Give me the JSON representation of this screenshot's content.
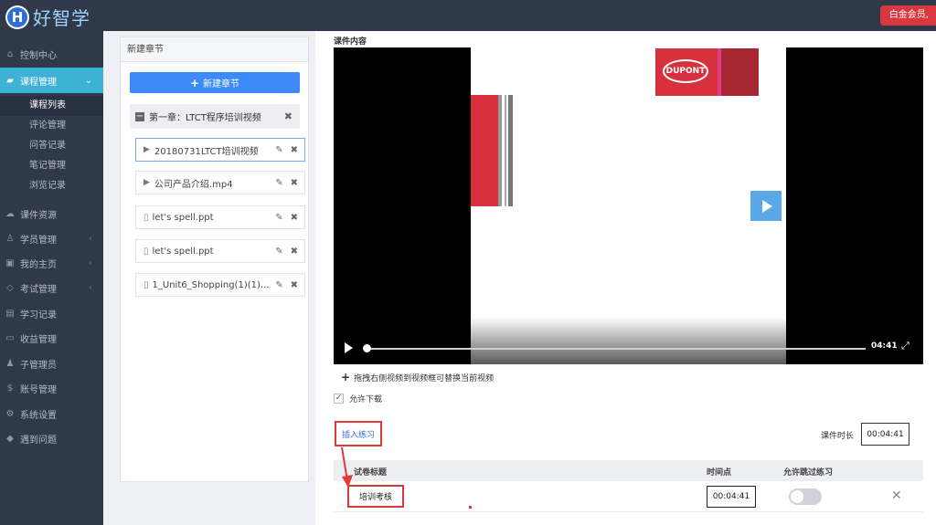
{
  "app": {
    "logo_letter": "H",
    "logo_text": "好智学",
    "member_badge": "白金会员,"
  },
  "sidebar": {
    "items": [
      {
        "label": "控制中心",
        "icon": "home-icon"
      },
      {
        "label": "课程管理",
        "icon": "book-icon",
        "active": true
      },
      {
        "label": "课件资源",
        "icon": "cloud-icon"
      },
      {
        "label": "学员管理",
        "icon": "users-icon"
      },
      {
        "label": "我的主页",
        "icon": "bookmark-icon"
      },
      {
        "label": "考试管理",
        "icon": "tag-icon"
      },
      {
        "label": "学习记录",
        "icon": "doc-icon"
      },
      {
        "label": "收益管理",
        "icon": "card-icon"
      },
      {
        "label": "子管理员",
        "icon": "user-icon"
      },
      {
        "label": "账号管理",
        "icon": "dollar-icon"
      },
      {
        "label": "系统设置",
        "icon": "gear-icon"
      },
      {
        "label": "遇到问题",
        "icon": "tag-icon"
      }
    ],
    "sub_items": [
      "课程列表",
      "评论管理",
      "问答记录",
      "笔记管理",
      "浏览记录"
    ]
  },
  "chapter_panel": {
    "title": "新建章节",
    "new_chapter_button": "新建章节",
    "chapter_label": "第一章：LTCT程序培训视频",
    "lessons": [
      {
        "label": "20180731LTCT培训视频",
        "type": "video"
      },
      {
        "label": "公司产品介绍.mp4",
        "type": "video"
      },
      {
        "label": "let's spell.ppt",
        "type": "doc"
      },
      {
        "label": "let's spell.ppt",
        "type": "doc"
      },
      {
        "label": "1_Unit6_Shopping(1)(1)...",
        "type": "doc"
      }
    ]
  },
  "content": {
    "section_title": "课件内容",
    "video": {
      "brand_text": "DUPONT",
      "time": "04:41",
      "progress": 0.0
    },
    "drag_hint": "拖拽右侧视频到视频框可替换当前视频",
    "allow_download": "允许下载",
    "insert_practice": "插入练习",
    "duration_label": "课件时长",
    "duration_value": "00:04:41",
    "table": {
      "headers": [
        "试卷标题",
        "时间点",
        "允许跳过练习"
      ],
      "rows": [
        {
          "title": "培训考核",
          "time_point": "00:04:41",
          "allow_skip": false
        }
      ]
    }
  },
  "colors": {
    "sidebar_bg": "#2f3949",
    "active_nav": "#3db2d6",
    "primary_button": "#3d8af7",
    "highlight_red": "#e23a3a"
  }
}
